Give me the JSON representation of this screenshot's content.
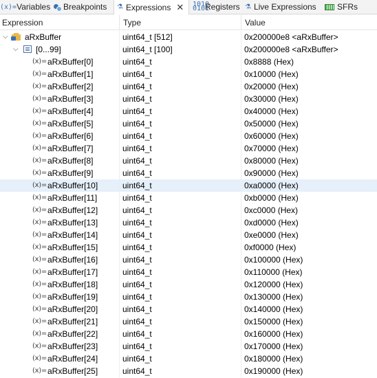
{
  "tabs": [
    {
      "icon": "variables-icon",
      "glyph": "(x)=",
      "label": "Variables"
    },
    {
      "icon": "breakpoints-icon",
      "glyph": "",
      "label": "Breakpoints"
    },
    {
      "icon": "expressions-icon",
      "glyph": "⚗",
      "label": "Expressions",
      "active": true,
      "close": "✕"
    },
    {
      "icon": "registers-icon",
      "glyph": "1010\n0101",
      "label": "Registers"
    },
    {
      "icon": "live-expressions-icon",
      "glyph": "⚗",
      "label": "Live Expressions"
    },
    {
      "icon": "sfrs-icon",
      "glyph": "",
      "label": "SFRs"
    }
  ],
  "columns": {
    "expression": "Expression",
    "type": "Type",
    "value": "Value"
  },
  "root": {
    "name": "aRxBuffer",
    "type": "uint64_t [512]",
    "value": "0x200000e8 <aRxBuffer>",
    "twisty": "⌵"
  },
  "group": {
    "name": "[0...99]",
    "type": "uint64_t [100]",
    "value": "0x200000e8 <aRxBuffer>",
    "twisty": "⌵"
  },
  "var_glyph": "(x)=",
  "elements": [
    {
      "name": "aRxBuffer[0]",
      "type": "uint64_t",
      "value": "0x8888 (Hex)"
    },
    {
      "name": "aRxBuffer[1]",
      "type": "uint64_t",
      "value": "0x10000 (Hex)"
    },
    {
      "name": "aRxBuffer[2]",
      "type": "uint64_t",
      "value": "0x20000 (Hex)"
    },
    {
      "name": "aRxBuffer[3]",
      "type": "uint64_t",
      "value": "0x30000 (Hex)"
    },
    {
      "name": "aRxBuffer[4]",
      "type": "uint64_t",
      "value": "0x40000 (Hex)"
    },
    {
      "name": "aRxBuffer[5]",
      "type": "uint64_t",
      "value": "0x50000 (Hex)"
    },
    {
      "name": "aRxBuffer[6]",
      "type": "uint64_t",
      "value": "0x60000 (Hex)"
    },
    {
      "name": "aRxBuffer[7]",
      "type": "uint64_t",
      "value": "0x70000 (Hex)"
    },
    {
      "name": "aRxBuffer[8]",
      "type": "uint64_t",
      "value": "0x80000 (Hex)"
    },
    {
      "name": "aRxBuffer[9]",
      "type": "uint64_t",
      "value": "0x90000 (Hex)"
    },
    {
      "name": "aRxBuffer[10]",
      "type": "uint64_t",
      "value": "0xa0000 (Hex)",
      "selected": true
    },
    {
      "name": "aRxBuffer[11]",
      "type": "uint64_t",
      "value": "0xb0000 (Hex)"
    },
    {
      "name": "aRxBuffer[12]",
      "type": "uint64_t",
      "value": "0xc0000 (Hex)"
    },
    {
      "name": "aRxBuffer[13]",
      "type": "uint64_t",
      "value": "0xd0000 (Hex)"
    },
    {
      "name": "aRxBuffer[14]",
      "type": "uint64_t",
      "value": "0xe0000 (Hex)"
    },
    {
      "name": "aRxBuffer[15]",
      "type": "uint64_t",
      "value": "0xf0000 (Hex)"
    },
    {
      "name": "aRxBuffer[16]",
      "type": "uint64_t",
      "value": "0x100000 (Hex)"
    },
    {
      "name": "aRxBuffer[17]",
      "type": "uint64_t",
      "value": "0x110000 (Hex)"
    },
    {
      "name": "aRxBuffer[18]",
      "type": "uint64_t",
      "value": "0x120000 (Hex)"
    },
    {
      "name": "aRxBuffer[19]",
      "type": "uint64_t",
      "value": "0x130000 (Hex)"
    },
    {
      "name": "aRxBuffer[20]",
      "type": "uint64_t",
      "value": "0x140000 (Hex)"
    },
    {
      "name": "aRxBuffer[21]",
      "type": "uint64_t",
      "value": "0x150000 (Hex)"
    },
    {
      "name": "aRxBuffer[22]",
      "type": "uint64_t",
      "value": "0x160000 (Hex)"
    },
    {
      "name": "aRxBuffer[23]",
      "type": "uint64_t",
      "value": "0x170000 (Hex)"
    },
    {
      "name": "aRxBuffer[24]",
      "type": "uint64_t",
      "value": "0x180000 (Hex)"
    },
    {
      "name": "aRxBuffer[25]",
      "type": "uint64_t",
      "value": "0x190000 (Hex)"
    }
  ],
  "colors": {
    "selected_row": "#e6f0fa",
    "icon_blue": "#3b6fb6",
    "folder": "#e8b84a"
  }
}
